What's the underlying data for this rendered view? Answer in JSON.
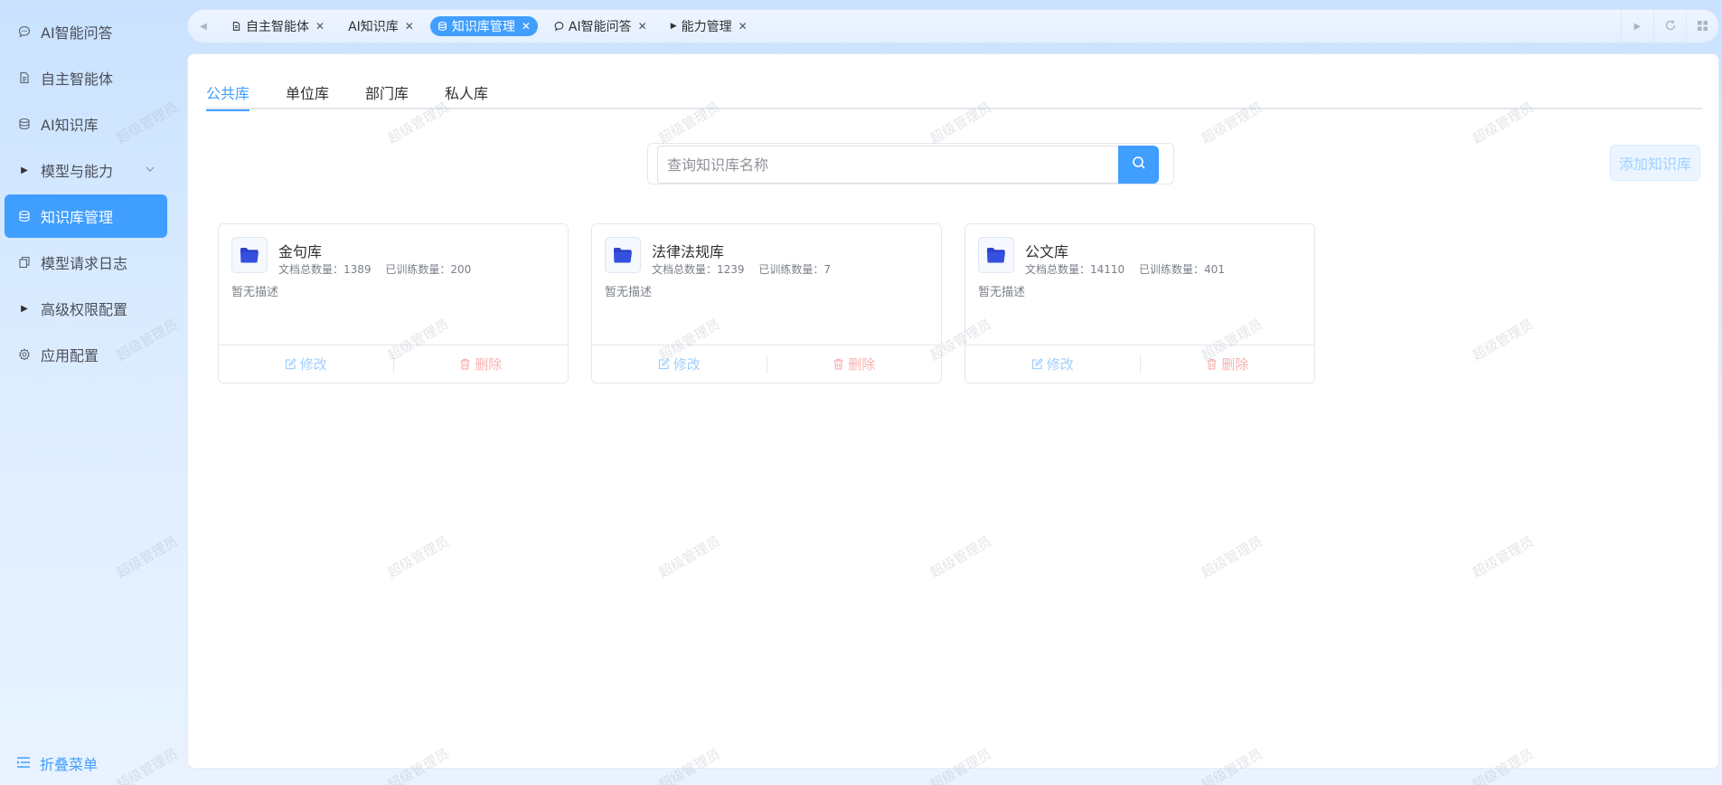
{
  "sidebar": {
    "items": [
      {
        "label": "AI智能问答",
        "icon": "chat-bubble-icon"
      },
      {
        "label": "自主智能体",
        "icon": "document-icon"
      },
      {
        "label": "AI知识库",
        "icon": "database-icon"
      },
      {
        "label": "模型与能力",
        "icon": "caret-right-icon"
      },
      {
        "label": "知识库管理",
        "icon": "database-icon"
      },
      {
        "label": "模型请求日志",
        "icon": "copy-icon"
      },
      {
        "label": "高级权限配置",
        "icon": "caret-right-icon"
      },
      {
        "label": "应用配置",
        "icon": "gear-icon"
      }
    ],
    "active_index": 4,
    "collapse_label": "折叠菜单"
  },
  "tabs": [
    {
      "label": "自主智能体",
      "icon": "document-icon"
    },
    {
      "label": "AI知识库",
      "icon": ""
    },
    {
      "label": "知识库管理",
      "icon": "database-icon"
    },
    {
      "label": "AI智能问答",
      "icon": "chat-bubble-icon"
    },
    {
      "label": "能力管理",
      "icon": "caret-right-icon"
    }
  ],
  "active_tab": 2,
  "library_tabs": [
    "公共库",
    "单位库",
    "部门库",
    "私人库"
  ],
  "active_library_tab": 0,
  "search": {
    "placeholder": "查询知识库名称"
  },
  "add_button": "添加知识库",
  "cards": [
    {
      "name": "金句库",
      "doc_label": "文档总数量：",
      "doc_count": "1389",
      "trained_label": "已训练数量：",
      "trained_count": "200",
      "desc": "暂无描述"
    },
    {
      "name": "法律法规库",
      "doc_label": "文档总数量：",
      "doc_count": "1239",
      "trained_label": "已训练数量：",
      "trained_count": "7",
      "desc": "暂无描述"
    },
    {
      "name": "公文库",
      "doc_label": "文档总数量：",
      "doc_count": "14110",
      "trained_label": "已训练数量：",
      "trained_count": "401",
      "desc": "暂无描述"
    }
  ],
  "card_actions": {
    "edit": "修改",
    "delete": "删除"
  },
  "watermark": "超级管理员",
  "colors": {
    "primary": "#409eff",
    "danger_light": "#f9b1b1",
    "primary_light": "#a0cfff"
  }
}
